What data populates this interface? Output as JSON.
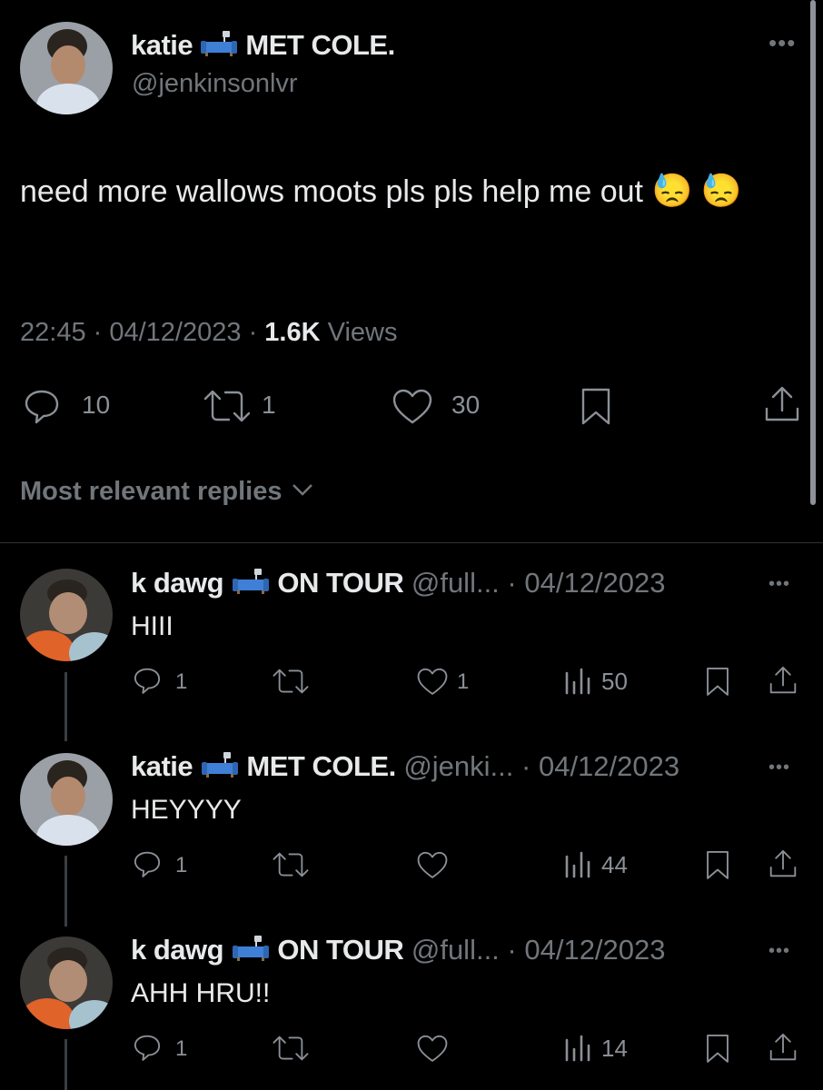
{
  "main_tweet": {
    "display_name_prefix": "katie",
    "display_name_suffix": "MET COLE.",
    "handle": "@jenkinsonlvr",
    "text": "need more wallows moots pls pls help me out",
    "emoji_1": "😓",
    "emoji_2": "😓",
    "time": "22:45",
    "date": "04/12/2023",
    "views_count": "1.6K",
    "views_label": "Views",
    "replies": "10",
    "retweets": "1",
    "likes": "30"
  },
  "replies_header": {
    "label": "Most relevant replies",
    "chevron": "chevron-down-icon"
  },
  "replies": [
    {
      "display_name_prefix": "k dawg",
      "display_name_suffix": "ON TOUR",
      "handle": "@full...",
      "date": "· 04/12/2023",
      "text": "HIII",
      "replies": "1",
      "likes": "1",
      "views": "50"
    },
    {
      "display_name_prefix": "katie",
      "display_name_suffix": "MET COLE.",
      "handle": "@jenki...",
      "date": "· 04/12/2023",
      "text": "HEYYYY",
      "replies": "1",
      "likes": "",
      "views": "44"
    },
    {
      "display_name_prefix": "k dawg",
      "display_name_suffix": "ON TOUR",
      "handle": "@full...",
      "date": "· 04/12/2023",
      "text": "AHH HRU!!",
      "replies": "1",
      "likes": "",
      "views": "14"
    }
  ],
  "colors": {
    "background": "#000000",
    "text": "#e7e9ea",
    "secondary": "#71767b",
    "couch_blue": "#3f7fd6"
  },
  "icons": {
    "more": "more-icon",
    "reply": "reply-icon",
    "retweet": "retweet-icon",
    "like": "heart-icon",
    "bookmark": "bookmark-icon",
    "share": "share-icon",
    "views": "views-icon",
    "couch": "couch-emoji-icon"
  }
}
